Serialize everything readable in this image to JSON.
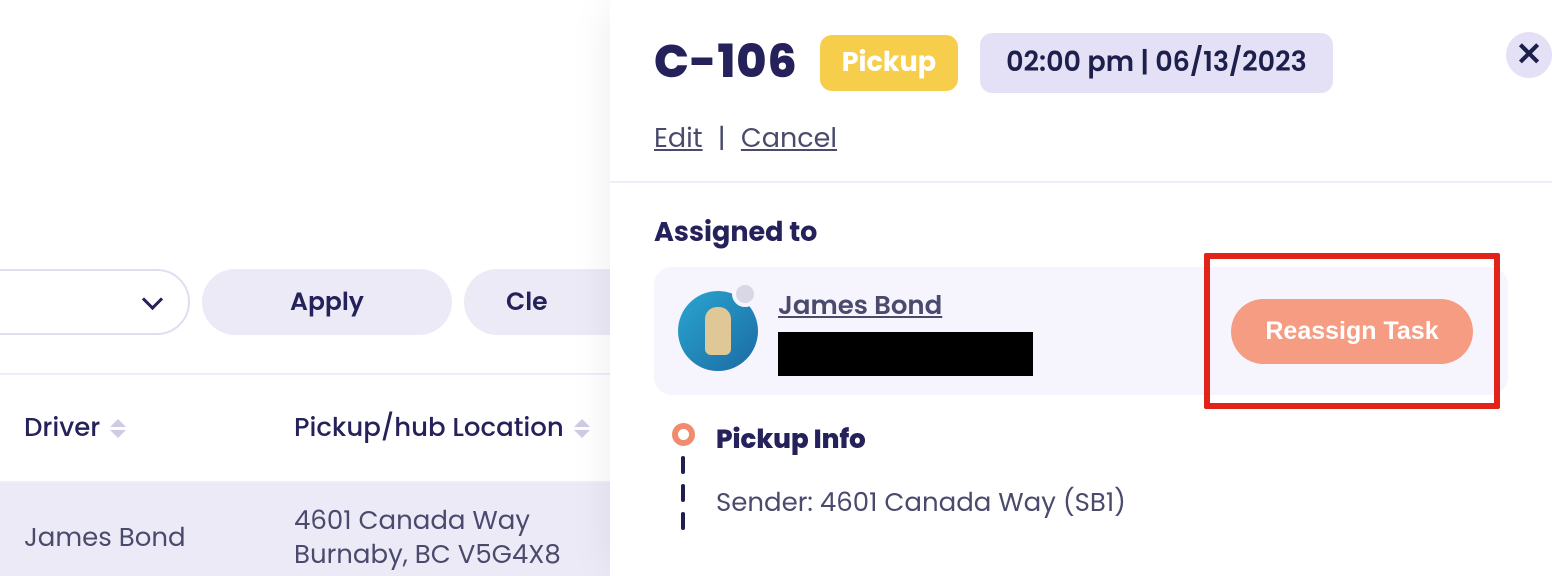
{
  "filters": {
    "apply_label": "Apply",
    "clear_label": "Cle"
  },
  "columns": {
    "driver": "Driver",
    "location": "Pickup/hub Location"
  },
  "row": {
    "driver": "James Bond",
    "location_line1": "4601 Canada Way",
    "location_line2": "Burnaby, BC V5G4X8"
  },
  "task": {
    "id": "C-106",
    "type_label": "Pickup",
    "datetime": "02:00 pm | 06/13/2023",
    "edit_label": "Edit",
    "cancel_label": "Cancel"
  },
  "assigned": {
    "section_title": "Assigned to",
    "name": "James Bond",
    "reassign_label": "Reassign Task"
  },
  "pickup": {
    "title": "Pickup Info",
    "sender_line": "Sender: 4601 Canada Way (SB1)"
  }
}
